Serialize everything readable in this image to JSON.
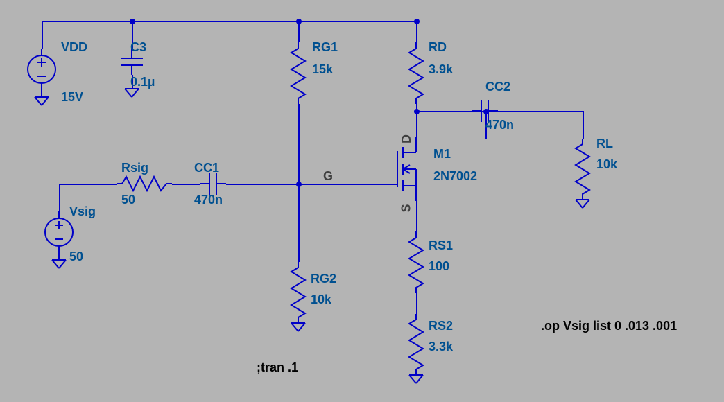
{
  "vdd": {
    "name": "VDD",
    "value": "15V"
  },
  "c3": {
    "name": "C3",
    "value": "0.1µ"
  },
  "rg1": {
    "name": "RG1",
    "value": "15k"
  },
  "rd": {
    "name": "RD",
    "value": "3.9k"
  },
  "cc2": {
    "name": "CC2",
    "value": "470n"
  },
  "rl": {
    "name": "RL",
    "value": "10k"
  },
  "m1": {
    "name": "M1",
    "value": "2N7002"
  },
  "rsig": {
    "name": "Rsig",
    "value": "50"
  },
  "cc1": {
    "name": "CC1",
    "value": "470n"
  },
  "vsig": {
    "name": "Vsig",
    "value": "50"
  },
  "rg2": {
    "name": "RG2",
    "value": "10k"
  },
  "rs1": {
    "name": "RS1",
    "value": "100"
  },
  "rs2": {
    "name": "RS2",
    "value": "3.3k"
  },
  "pins": {
    "d": "D",
    "g": "G",
    "s": "S"
  },
  "directives": {
    "tran": ";tran .1",
    "op": ".op Vsig list 0 .013 .001"
  }
}
